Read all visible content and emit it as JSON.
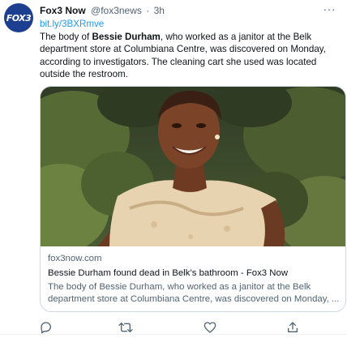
{
  "tweet": {
    "author_name": "Fox3 Now",
    "handle": "@fox3news",
    "separator": "·",
    "time": "3h",
    "more_label": "···",
    "avatar_text": "FOX3",
    "link": "bit.ly/3BXRmve",
    "text_part1": "The body of ",
    "text_bold": "Bessie Durham",
    "text_part2": ", who worked as a janitor at the Belk department store at Columbiana Centre, was discovered on Monday, according to investigators. The cleaning cart she used was located outside the restroom."
  },
  "card": {
    "domain": "fox3now.com",
    "title": "Bessie Durham found dead in Belk’s bathroom - Fox3 Now",
    "description": "The body of Bessie Durham, who worked as a janitor at the Belk department store at Columbiana Centre, was discovered on Monday, ..."
  },
  "actions": {
    "reply_icon": "reply-icon",
    "retweet_icon": "retweet-icon",
    "like_icon": "like-icon",
    "share_icon": "share-icon"
  },
  "colors": {
    "link": "#1d9bf0",
    "secondary_text": "#536471",
    "avatar_bg": "#1d3f8f",
    "card_border": "#cfd9de"
  }
}
